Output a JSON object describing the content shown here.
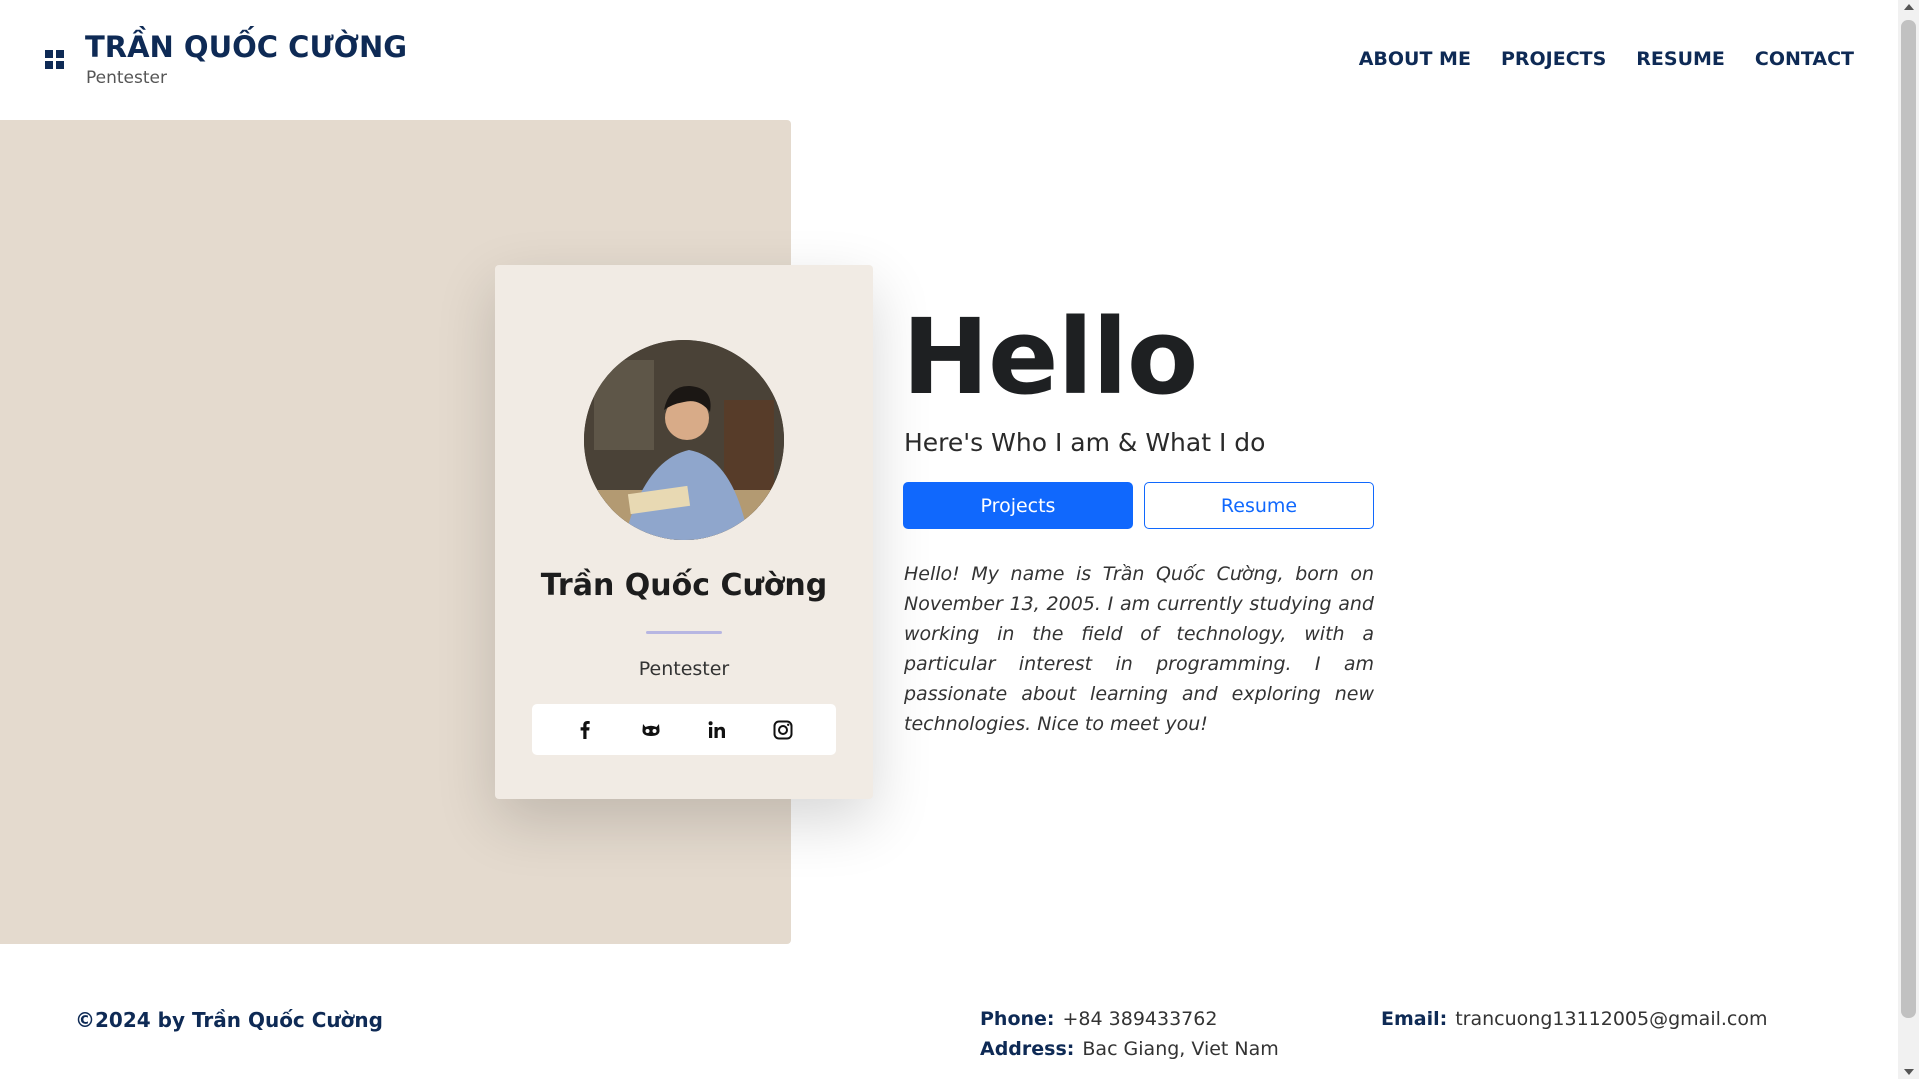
{
  "header": {
    "title": "TRẦN QUỐC CƯỜNG",
    "subtitle": "Pentester",
    "nav": [
      "ABOUT ME",
      "PROJECTS",
      "RESUME",
      "CONTACT"
    ]
  },
  "card": {
    "name": "Trần Quốc Cường",
    "role": "Pentester",
    "social_icons": [
      "facebook-icon",
      "github-icon",
      "linkedin-icon",
      "instagram-icon"
    ]
  },
  "hero": {
    "heading": "Hello",
    "tagline": "Here's Who I am & What I do",
    "primary_button": "Projects",
    "secondary_button": "Resume",
    "bio": "Hello! My name is Trần Quốc Cường, born on November 13, 2005. I am currently studying and working in the field of technology, with a particular interest in programming. I am passionate about learning and exploring new technologies. Nice to meet you!"
  },
  "footer": {
    "copyright": "©2024 by Trần Quốc Cường",
    "phone_label": "Phone:",
    "phone": "+84 389433762",
    "address_label": "Address:",
    "address": "Bac Giang, Viet Nam",
    "email_label": "Email:",
    "email": "trancuong13112005@gmail.com"
  },
  "colors": {
    "brand": "#0e2a55",
    "accent": "#1068fd",
    "hero_bg": "#e4dace",
    "card_bg": "#f1ebe4"
  }
}
